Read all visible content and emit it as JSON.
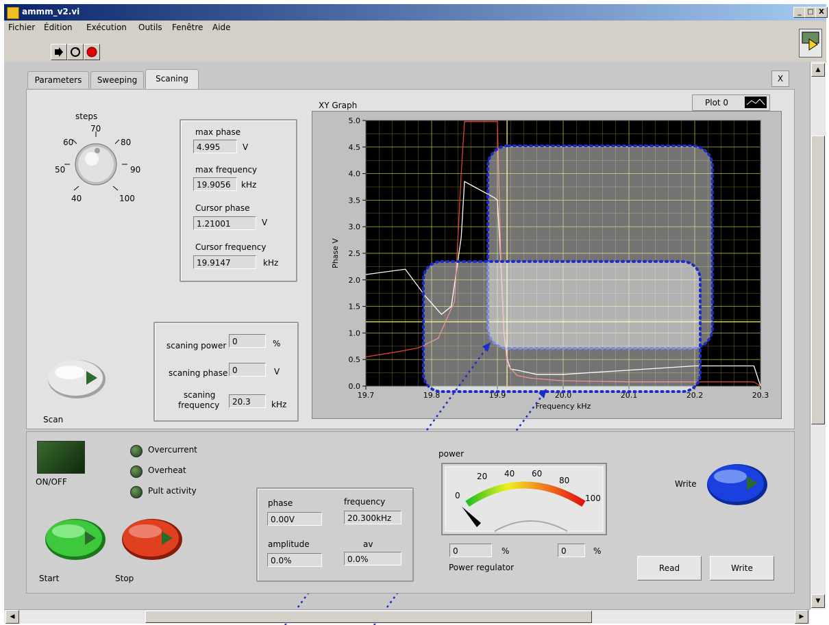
{
  "window": {
    "title": "ammm_v2.vi",
    "min_label": "_",
    "max_label": "□",
    "close_label": "X"
  },
  "menu": [
    "Fichier",
    "Édition",
    "Exécution",
    "Outils",
    "Fenêtre",
    "Aide"
  ],
  "tabs": {
    "items": [
      "Parameters",
      "Sweeping",
      "Scaning"
    ],
    "active": "Scaning",
    "close_label": "X"
  },
  "steps_knob": {
    "label": "steps",
    "scale": [
      "40",
      "50",
      "60",
      "70",
      "80",
      "90",
      "100"
    ]
  },
  "readouts": {
    "max_phase_label": "max phase",
    "max_phase": "4.995",
    "max_phase_unit": "V",
    "max_freq_label": "max frequency",
    "max_freq": "19.9056",
    "max_freq_unit": "kHz",
    "cursor_phase_label": "Cursor phase",
    "cursor_phase": "1.21001",
    "cursor_phase_unit": "V",
    "cursor_freq_label": "Cursor  frequency",
    "cursor_freq": "19.9147",
    "cursor_freq_unit": "kHz"
  },
  "scan_settings": {
    "power_label": "scaning power",
    "power": "0",
    "power_unit": "%",
    "phase_label": "scaning phase",
    "phase": "0",
    "phase_unit": "V",
    "freq_label_1": "scaning",
    "freq_label_2": "frequency",
    "freq": "20.3",
    "freq_unit": "kHz"
  },
  "scan_button_label": "Scan",
  "graph": {
    "title": "XY Graph",
    "legend": "Plot 0"
  },
  "chart_data": {
    "type": "line",
    "title": "XY Graph",
    "xlabel": "Frequency  kHz",
    "ylabel": "Phase V",
    "xlim": [
      19.7,
      20.3
    ],
    "ylim": [
      0.0,
      5.0
    ],
    "xticks": [
      "19.7",
      "19.8",
      "19.9",
      "20.0",
      "20.1",
      "20.2",
      "20.3"
    ],
    "yticks": [
      "0.0",
      "0.5",
      "1.0",
      "1.5",
      "2.0",
      "2.5",
      "3.0",
      "3.5",
      "4.0",
      "4.5",
      "5.0"
    ],
    "cursor": {
      "x": 19.9147,
      "y": 1.21001
    },
    "grid": true,
    "series": [
      {
        "name": "Plot 0",
        "color": "#ffffff",
        "x": [
          19.7,
          19.76,
          19.79,
          19.815,
          19.83,
          19.845,
          19.85,
          19.865,
          19.895,
          19.9,
          19.905,
          19.91,
          19.915,
          19.92,
          19.93,
          19.96,
          20.0,
          20.1,
          20.2,
          20.29,
          20.3
        ],
        "y": [
          2.1,
          2.2,
          1.7,
          1.35,
          1.5,
          2.8,
          3.85,
          3.75,
          3.55,
          3.5,
          2.4,
          1.0,
          0.5,
          0.32,
          0.3,
          0.22,
          0.22,
          0.3,
          0.38,
          0.38,
          0.0
        ]
      },
      {
        "name": "",
        "color": "#e04030",
        "x": [
          19.7,
          19.75,
          19.78,
          19.81,
          19.835,
          19.845,
          19.85,
          19.9,
          19.905,
          19.91,
          19.915,
          19.93,
          19.95,
          20.0,
          20.1,
          20.2,
          20.29,
          20.3
        ],
        "y": [
          0.55,
          0.65,
          0.72,
          0.9,
          1.6,
          4.0,
          4.98,
          4.98,
          2.5,
          1.0,
          0.4,
          0.2,
          0.15,
          0.1,
          0.08,
          0.08,
          0.08,
          0.0
        ]
      }
    ]
  },
  "status_leds": [
    "Overcurrent",
    "Overheat",
    "Pult activity"
  ],
  "onoff_label": "ON/OFF",
  "start_label": "Start",
  "stop_label": "Stop",
  "values_box": {
    "phase_label": "phase",
    "phase": "0.00V",
    "freq_label": "frequency",
    "freq": "20.300kHz",
    "amp_label": "amplitude",
    "amp": "0.0%",
    "av_label": "av",
    "av": "0.0%"
  },
  "power_gauge": {
    "label": "power",
    "scale": [
      "0",
      "20",
      "40",
      "60",
      "80",
      "100"
    ],
    "value": 0
  },
  "power_regulator": {
    "label": "Power regulator",
    "value1": "0",
    "unit1": "%",
    "value2": "0",
    "unit2": "%"
  },
  "write_top_label": "Write",
  "read_button": "Read",
  "write_button": "Write"
}
